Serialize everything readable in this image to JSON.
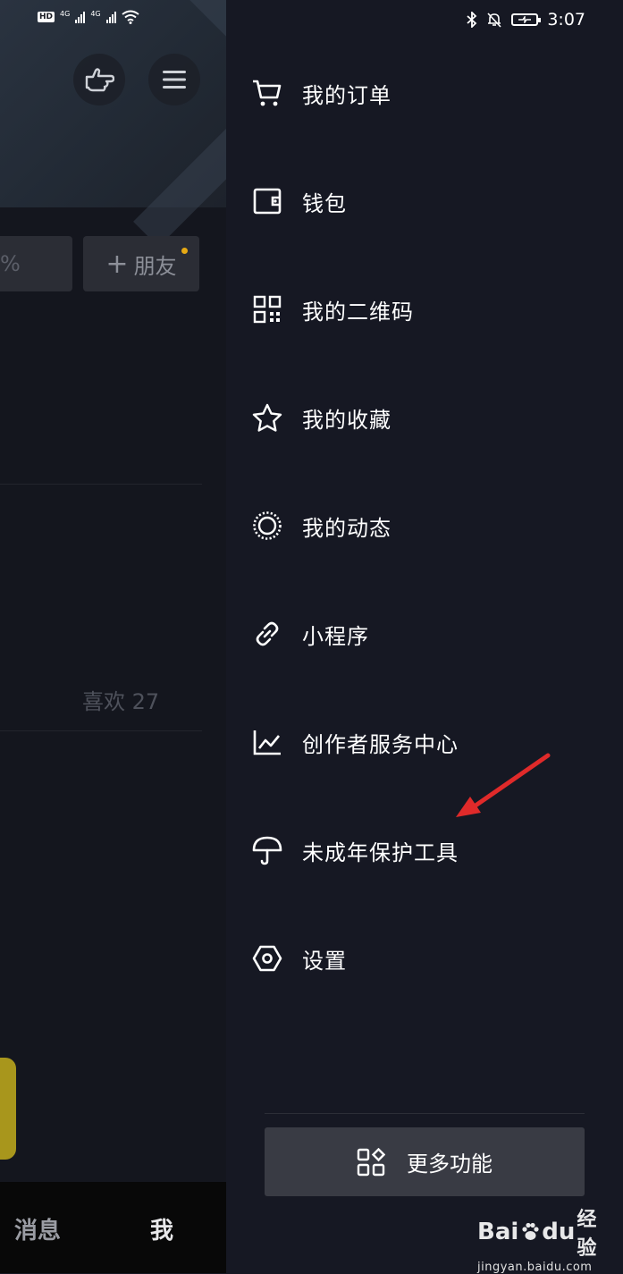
{
  "status_bar": {
    "left": {
      "hd": "HD",
      "net1": "4G",
      "net2": "4G"
    },
    "right": {
      "time": "3:07"
    }
  },
  "background_page": {
    "percent_fragment": "%",
    "add_friend_label": "朋友",
    "add_friend_plus": "+",
    "likes_label": "喜欢 27",
    "nav": {
      "messages": "消息",
      "me": "我"
    },
    "notification_dot_color": "#e6a914"
  },
  "drawer": {
    "menu_items": [
      {
        "icon": "cart-icon",
        "label": "我的订单"
      },
      {
        "icon": "wallet-icon",
        "label": "钱包"
      },
      {
        "icon": "qr-code-icon",
        "label": "我的二维码"
      },
      {
        "icon": "star-icon",
        "label": "我的收藏"
      },
      {
        "icon": "dotted-circle-icon",
        "label": "我的动态"
      },
      {
        "icon": "link-icon",
        "label": "小程序"
      },
      {
        "icon": "chart-icon",
        "label": "创作者服务中心"
      },
      {
        "icon": "umbrella-icon",
        "label": "未成年保护工具"
      },
      {
        "icon": "hexagon-icon",
        "label": "设置"
      }
    ],
    "more_button_label": "更多功能",
    "annotation_arrow_color": "#e02a2a"
  },
  "watermark": {
    "brand": "Bai",
    "brand2": "du",
    "product": "经验",
    "url": "jingyan.baidu.com"
  }
}
